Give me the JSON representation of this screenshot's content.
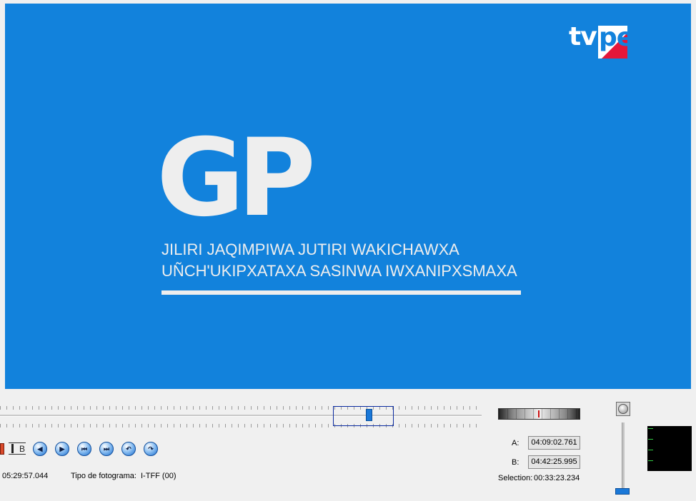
{
  "video": {
    "logo_tv": "tv",
    "logo_pe": "pe",
    "gp_text": "GP",
    "tagline_1": "JILIRI JAQIMPIWA JUTIRI WAKICHAWXA",
    "tagline_2": "UÑCH'UKIPXATAXA SASINWA IWXANIPXSMAXA"
  },
  "toolbar": {
    "mark_b_label": "B",
    "buttons": [
      {
        "icon": "mark-in-icon",
        "glyph": "◀"
      },
      {
        "icon": "mark-out-icon",
        "glyph": "▶"
      },
      {
        "icon": "go-to-start-icon",
        "glyph": "⏮"
      },
      {
        "icon": "go-to-end-icon",
        "glyph": "⏭"
      },
      {
        "icon": "previous-keyframe-icon",
        "glyph": "↶"
      },
      {
        "icon": "next-keyframe-icon",
        "glyph": "↷"
      }
    ]
  },
  "status": {
    "current_time": "05:29:57.044",
    "frame_type_label": "Tipo de fotograma:",
    "frame_type_value": "I-TFF (00)"
  },
  "selection": {
    "a_label": "A:",
    "a_value": "04:09:02.761",
    "b_label": "B:",
    "b_value": "04:42:25.995",
    "selection_label": "Selection:",
    "selection_value": "00:33:23.234"
  },
  "colors": {
    "video_background": "#1282dc",
    "logo_red": "#e4173a",
    "accent": "#1a78d8"
  }
}
